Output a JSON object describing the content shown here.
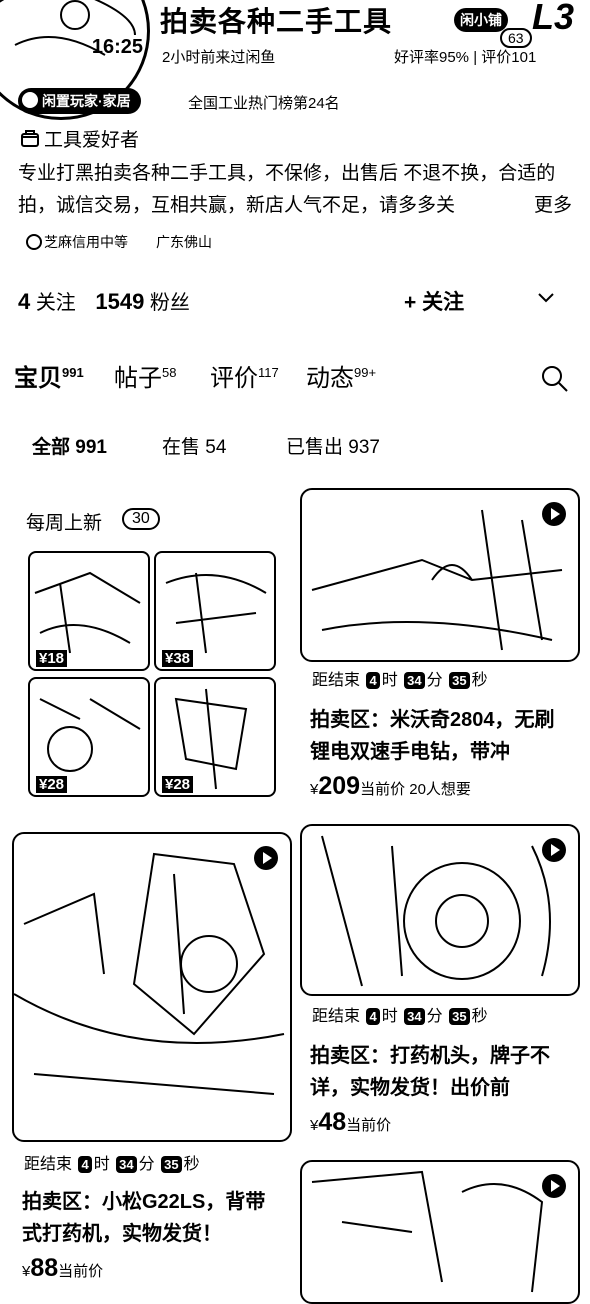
{
  "shop": {
    "avatar_time": "16:25",
    "name": "拍卖各种二手工具",
    "last_seen": "2小时前来过闲鱼",
    "badge": "闲小铺",
    "level": "L3",
    "fans_chip": "63",
    "rating": "好评率95% | 评价101",
    "tag": "闲置玩家·家居",
    "rank": "全国工业热门榜第24名",
    "hobby": "工具爱好者",
    "intro": "专业打黑拍卖各种二手工具，不保修，出售后 不退不换，合适的拍，诚信交易，互相共赢，新店人气不足，请多多关",
    "intro_more": "更多",
    "credit": "芝麻信用中等",
    "location": "广东佛山",
    "following_count": "4",
    "following_label": "关注",
    "fans_count": "1549",
    "fans_label": "粉丝",
    "follow_button": "+ 关注"
  },
  "tabs": [
    {
      "label": "宝贝",
      "count": "991"
    },
    {
      "label": "帖子",
      "count": "58"
    },
    {
      "label": "评价",
      "count": "117"
    },
    {
      "label": "动态",
      "count": "99+"
    }
  ],
  "filters": [
    "全部 991",
    "在售 54",
    "已售出 937"
  ],
  "weekly": {
    "title": "每周上新",
    "count": "30",
    "thumbs": [
      {
        "price": "¥18"
      },
      {
        "price": "¥38"
      },
      {
        "price": "¥28"
      },
      {
        "price": "¥28"
      }
    ]
  },
  "countdown": {
    "prefix": "距结束",
    "h": "4",
    "h_label": "时",
    "m": "34",
    "m_label": "分",
    "s": "35",
    "s_label": "秒"
  },
  "items": [
    {
      "title": "拍卖区：米沃奇2804，无刷锂电双速手电钻，带冲",
      "currency": "¥",
      "price": "209",
      "price_label": "当前价",
      "want": "20人想要"
    },
    {
      "title": "拍卖区：打药机头，牌子不详，实物发货！出价前",
      "currency": "¥",
      "price": "48",
      "price_label": "当前价",
      "want": ""
    },
    {
      "title": "拍卖区：小松G22LS，背带式打药机，实物发货！",
      "currency": "¥",
      "price": "88",
      "price_label": "当前价",
      "want": ""
    }
  ],
  "icons": [
    "search-icon",
    "chevron-down-icon",
    "play-icon",
    "shop-icon"
  ]
}
